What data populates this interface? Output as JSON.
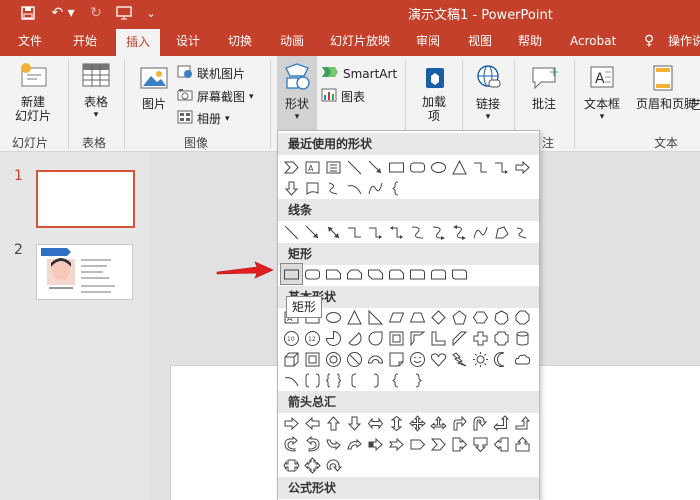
{
  "window": {
    "title": "演示文稿1  -  PowerPoint"
  },
  "tabs": [
    "文件",
    "开始",
    "插入",
    "设计",
    "切换",
    "动画",
    "幻灯片放映",
    "审阅",
    "视图",
    "帮助",
    "Acrobat",
    "操作说"
  ],
  "active_tab_index": 2,
  "ribbon": {
    "new_slide": "新建\n幻灯片",
    "table": "表格",
    "picture": "图片",
    "online_pictures": "联机图片",
    "screenshot": "屏幕截图",
    "album": "相册",
    "shapes": "形状",
    "smartart": "SmartArt",
    "chart": "图表",
    "addins": "加载\n项",
    "link": "链接",
    "comment": "批注",
    "textbox": "文本框",
    "header_footer": "页眉和页脚",
    "art": "艺",
    "groups": {
      "slides": "幻灯片",
      "tables": "表格",
      "images": "图像",
      "comments": "注",
      "text": "文本"
    }
  },
  "slides": {
    "num1": "1",
    "num2": "2"
  },
  "shapes_menu": {
    "recent": "最近使用的形状",
    "lines": "线条",
    "rectangles": "矩形",
    "basic": "基本形状",
    "arrows": "箭头总汇",
    "equation": "公式形状",
    "tooltip": "矩形"
  },
  "colors": {
    "accent": "#c4402a",
    "arrow": "#e02020"
  }
}
